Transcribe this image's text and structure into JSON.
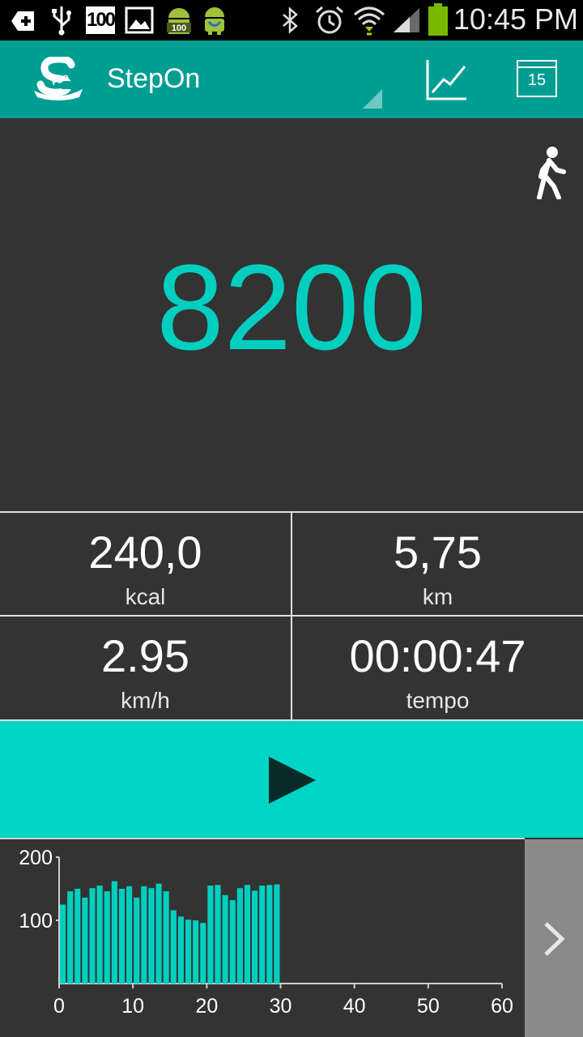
{
  "status_bar": {
    "time": "10:45 PM",
    "icons": [
      "add-notification-icon",
      "usb-icon",
      "battery-100-badge-icon",
      "image-icon",
      "android-100-icon",
      "android-icon",
      "bluetooth-icon",
      "alarm-icon",
      "wifi-icon",
      "signal-icon",
      "battery-icon"
    ],
    "badge_text": "100"
  },
  "action_bar": {
    "app_name": "StepOn",
    "logo_badge": "PRO",
    "calendar_day": "15",
    "colors": {
      "bar": "#009e92",
      "accent": "#00cfc0"
    }
  },
  "main": {
    "steps": "8200",
    "mode_icon": "walking-person-icon"
  },
  "stats": [
    {
      "value": "240,0",
      "unit": "kcal"
    },
    {
      "value": "5,75",
      "unit": "km"
    },
    {
      "value": "2.95",
      "unit": "km/h"
    },
    {
      "value": "00:00:47",
      "unit": "tempo"
    }
  ],
  "controls": {
    "play_icon": "play-icon",
    "next_icon": "chevron-right-icon"
  },
  "chart_data": {
    "type": "bar",
    "x": [
      1,
      2,
      3,
      4,
      5,
      6,
      7,
      8,
      9,
      10,
      11,
      12,
      13,
      14,
      15,
      16,
      17,
      18,
      19,
      20,
      21,
      22,
      23,
      24,
      25,
      26,
      27,
      28,
      29,
      30
    ],
    "values": [
      125,
      146,
      150,
      136,
      151,
      155,
      146,
      162,
      150,
      154,
      136,
      154,
      151,
      158,
      146,
      116,
      106,
      101,
      100,
      96,
      155,
      156,
      140,
      132,
      151,
      156,
      147,
      155,
      156,
      157
    ],
    "ylim": [
      0,
      200
    ],
    "xlim": [
      0,
      60
    ],
    "yticks": [
      "100",
      "200"
    ],
    "xticks": [
      "0",
      "10",
      "20",
      "30",
      "40",
      "50",
      "60"
    ],
    "color": "#00cfc0"
  }
}
